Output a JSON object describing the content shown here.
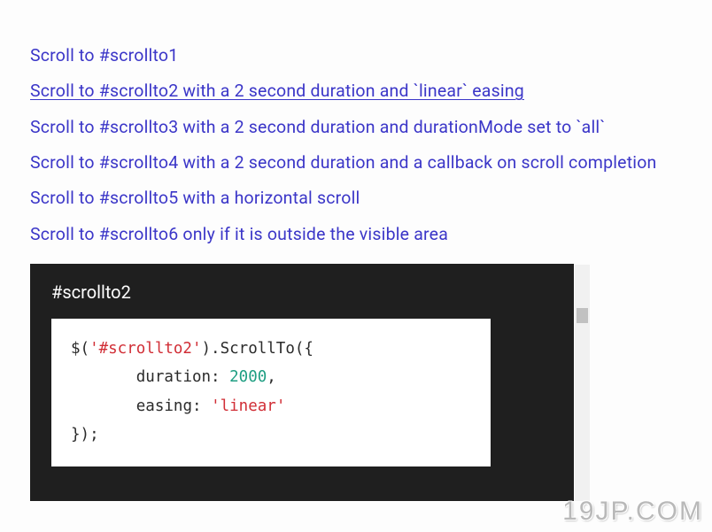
{
  "links": [
    {
      "label": "Scroll to #scrollto1",
      "underlined": false
    },
    {
      "label": "Scroll to #scrollto2 with a 2 second duration and `linear` easing",
      "underlined": true
    },
    {
      "label": "Scroll to #scrollto3 with a 2 second duration and durationMode set to `all`",
      "underlined": false
    },
    {
      "label": "Scroll to #scrollto4 with a 2 second duration and a callback on scroll completion",
      "underlined": false
    },
    {
      "label": "Scroll to #scrollto5 with a horizontal scroll",
      "underlined": false
    },
    {
      "label": "Scroll to #scrollto6 only if it is outside the visible area",
      "underlined": false
    }
  ],
  "panel": {
    "title": "#scrollto2",
    "code": {
      "line1": {
        "p1": "$(",
        "str": "'#scrollto2'",
        "p2": ").ScrollTo({"
      },
      "line2": {
        "indent": "       ",
        "key": "duration: ",
        "num": "2000",
        "tail": ","
      },
      "line3": {
        "indent": "       ",
        "key": "easing: ",
        "str": "'linear'"
      },
      "line4": "});"
    }
  },
  "watermark": "19JP.COM"
}
